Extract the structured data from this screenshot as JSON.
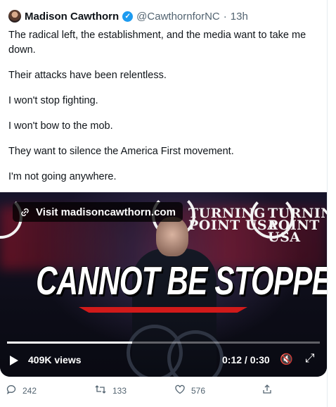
{
  "author": {
    "name": "Madison Cawthorn",
    "handle": "@CawthornforNC",
    "separator": "·",
    "time": "13h",
    "verified_icon": "verified-badge-icon",
    "verified_mark": "✓"
  },
  "tweet_text": [
    "The radical left, the establishment, and the media want to take me down.",
    "Their attacks have been relentless.",
    "I won't stop fighting.",
    "I won't bow to the mob.",
    "They want to silence the America First movement.",
    "I'm not going anywhere."
  ],
  "media": {
    "link_label": "Visit madisoncawthorn.com",
    "link_icon": "link-icon",
    "backdrop_logo_text": [
      "TURNING",
      "POINT USA"
    ],
    "overlay_title": "CANNOT BE STOPPED",
    "views": "409K views",
    "timecode": "0:12 / 0:30",
    "progress_fraction": 0.4,
    "mute_icon": "mute-icon",
    "mute_glyph": "🔇",
    "expand_icon": "expand-icon",
    "expand_glyph": "⤢",
    "accent_color": "#d11a1a"
  },
  "actions": {
    "reply": {
      "count": "242",
      "icon": "reply-icon",
      "glyph": "💬"
    },
    "retweet": {
      "count": "133",
      "icon": "retweet-icon",
      "glyph": "⇄"
    },
    "like": {
      "count": "576",
      "icon": "heart-icon",
      "glyph": "♡"
    },
    "share": {
      "icon": "share-icon",
      "glyph": "⇧"
    }
  }
}
